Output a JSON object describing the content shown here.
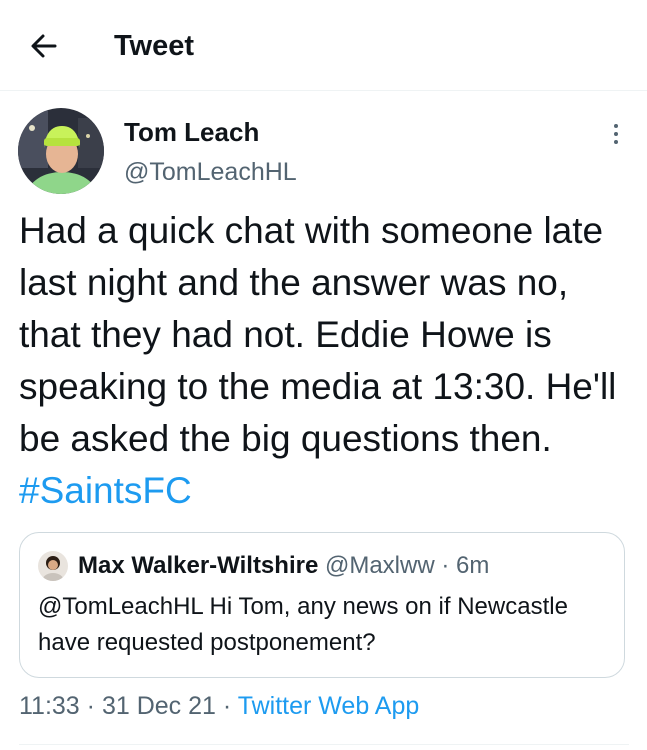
{
  "header": {
    "back_icon": "arrow-left-icon",
    "title": "Tweet"
  },
  "tweet": {
    "author_name": "Tom Leach",
    "author_handle": "@TomLeachHL",
    "more_icon": "vertical-ellipsis-icon",
    "text": "Had a quick chat with someone late last night and the answer was no, that they had not. Eddie Howe is speaking to the media at 13:30. He'll be asked the big questions then.",
    "hashtag": "#SaintsFC",
    "time": "11:33",
    "date": "31 Dec 21",
    "separator": "·",
    "source": "Twitter Web App"
  },
  "quote": {
    "author_name": "Max Walker-Wiltshire",
    "author_handle": "@Maxlww",
    "separator": "·",
    "time_ago": "6m",
    "text": "@TomLeachHL Hi Tom, any news on if Newcastle have requested postponement?"
  },
  "colors": {
    "accent": "#1d9bf0",
    "text_primary": "#0f1419",
    "text_secondary": "#536471",
    "border": "#cfd9de"
  }
}
